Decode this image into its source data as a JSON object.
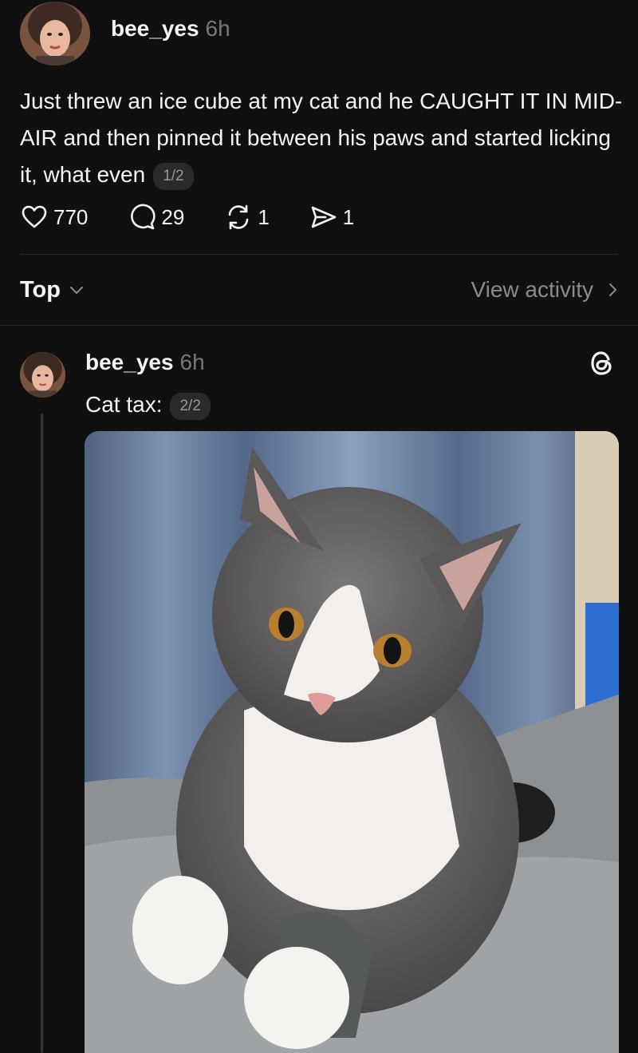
{
  "post": {
    "username": "bee_yes",
    "time": "6h",
    "text": "Just threw an ice cube at my cat and he CAUGHT IT IN MID-AIR and then pinned it between his paws and started licking it, what even",
    "counter": "1/2",
    "likes": "770",
    "comments": "29",
    "reposts": "1",
    "shares": "1"
  },
  "sort": {
    "label": "Top",
    "view_activity": "View activity"
  },
  "reply": {
    "username": "bee_yes",
    "time": "6h",
    "text": "Cat tax:",
    "counter": "2/2",
    "image_alt": "gray and white cat sitting on a gray couch"
  },
  "icons": {
    "like": "heart-icon",
    "comment": "comment-bubble-icon",
    "repost": "repost-icon",
    "share": "send-icon",
    "sort_chevron": "chevron-down-icon",
    "activity_chevron": "chevron-right-icon",
    "threads": "threads-logo-icon"
  },
  "colors": {
    "background": "#101010",
    "text": "#f3f5f7",
    "muted": "#777777"
  }
}
